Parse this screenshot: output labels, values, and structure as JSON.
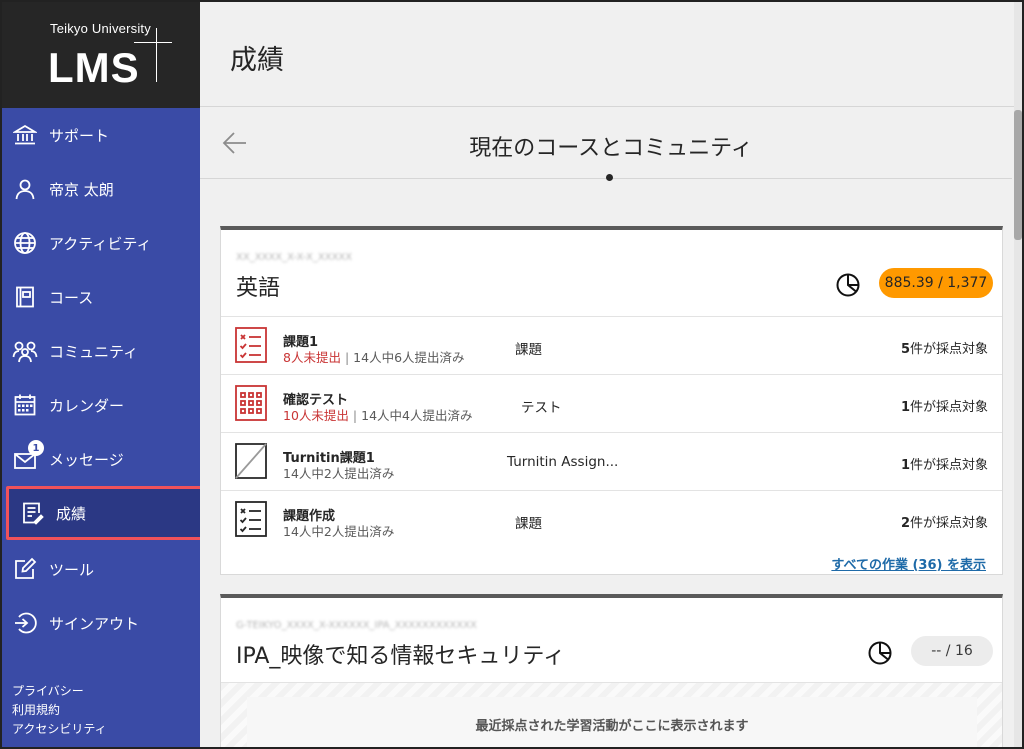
{
  "brand": {
    "university": "Teikyo University",
    "product": "LMS"
  },
  "nav": {
    "items": [
      {
        "label": "サポート",
        "icon": "institution-icon"
      },
      {
        "label": "帝京 太朗",
        "icon": "user-icon"
      },
      {
        "label": "アクティビティ",
        "icon": "globe-icon"
      },
      {
        "label": "コース",
        "icon": "book-icon"
      },
      {
        "label": "コミュニティ",
        "icon": "people-icon"
      },
      {
        "label": "カレンダー",
        "icon": "calendar-icon"
      },
      {
        "label": "メッセージ",
        "icon": "envelope-icon",
        "badge": "1"
      },
      {
        "label": "成績",
        "icon": "grades-icon",
        "active": true
      },
      {
        "label": "ツール",
        "icon": "tools-icon"
      },
      {
        "label": "サインアウト",
        "icon": "sign-out-icon"
      }
    ],
    "footer": [
      "プライバシー",
      "利用規約",
      "アクセシビリティ"
    ]
  },
  "header": {
    "title": "成績"
  },
  "section": {
    "title": "現在のコースとコミュニティ"
  },
  "courses": [
    {
      "id": "XX_XXXX_X-X-X_XXXXX",
      "name": "英語",
      "grade": "885.39 / 1,377",
      "grade_color": "#ff9900",
      "items": [
        {
          "name": "課題1",
          "missing": "8人未提出",
          "submitted": "14人中6人提出済み",
          "type": "課題",
          "count": "5",
          "count_suffix": "件が採点対象",
          "icon": "assignment-icon"
        },
        {
          "name": "確認テスト",
          "missing": "10人未提出",
          "submitted": "14人中4人提出済み",
          "type": "テスト",
          "count": "1",
          "count_suffix": "件が採点対象",
          "icon": "test-icon"
        },
        {
          "name": "Turnitin課題1",
          "missing": "",
          "submitted": "14人中2人提出済み",
          "type": "Turnitin Assign...",
          "count": "1",
          "count_suffix": "件が採点対象",
          "icon": "turnitin-icon"
        },
        {
          "name": "課題作成",
          "missing": "",
          "submitted": "14人中2人提出済み",
          "type": "課題",
          "count": "2",
          "count_suffix": "件が採点対象",
          "icon": "assignment-outline-icon"
        }
      ],
      "view_all": "すべての作業 (36) を表示"
    },
    {
      "id": "G-TEIKYO_XXXX_X-XXXXXX_IPA_XXXXXXXXXXXX",
      "name": "IPA_映像で知る情報セキュリティ",
      "grade": "-- / 16",
      "grade_color": "#ececec",
      "empty_message": "最近採点された学習活動がここに表示されます"
    }
  ]
}
